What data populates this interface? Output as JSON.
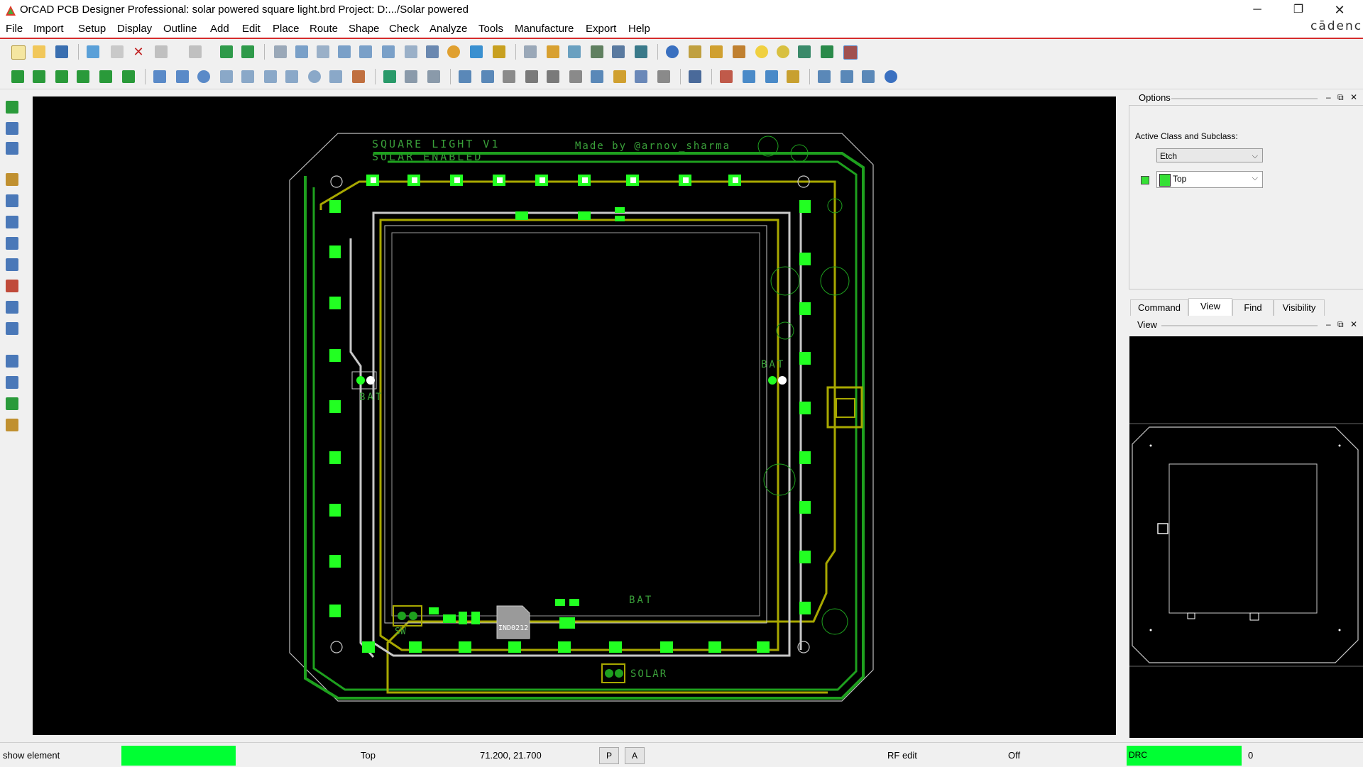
{
  "window": {
    "title": "OrCAD PCB Designer Professional: solar powered square light.brd  Project: D:.../Solar powered",
    "minimize_symbol": "─",
    "maximize_symbol": "❐",
    "close_symbol": "✕"
  },
  "brand": "cādence",
  "menu": [
    {
      "label": "File"
    },
    {
      "label": "Import"
    },
    {
      "label": "Setup"
    },
    {
      "label": "Display"
    },
    {
      "label": "Outline"
    },
    {
      "label": "Add"
    },
    {
      "label": "Edit"
    },
    {
      "label": "Place"
    },
    {
      "label": "Route"
    },
    {
      "label": "Shape"
    },
    {
      "label": "Check"
    },
    {
      "label": "Analyze"
    },
    {
      "label": "Tools"
    },
    {
      "label": "Manufacture"
    },
    {
      "label": "Export"
    },
    {
      "label": "Help"
    }
  ],
  "board": {
    "silkscreen_title_line1": "SQUARE LIGHT V1",
    "silkscreen_title_line2": "SOLAR ENABLED",
    "silkscreen_credit": "Made by @arnov_sharma",
    "label_bat_left": "BAT",
    "label_bat_right": "BAT",
    "label_bat_bottom": "BAT",
    "label_sw": "SW",
    "label_solar": "SOLAR",
    "label_ic": "IND0212"
  },
  "colors": {
    "etch_green": "#1ea01e",
    "bright_green": "#22ff22",
    "copper_yellow": "#a8a800",
    "trace_grey": "#c8c8c8",
    "silk_green": "#3aa03a",
    "status_green": "#00ff33"
  },
  "options_panel": {
    "title": "Options",
    "active_class_label": "Active Class and Subclass:",
    "class_value": "Etch",
    "subclass_value": "Top"
  },
  "tabs": [
    {
      "label": "Command"
    },
    {
      "label": "View"
    },
    {
      "label": "Find"
    },
    {
      "label": "Visibility"
    }
  ],
  "view_panel": {
    "title": "View"
  },
  "statusbar": {
    "message": "show element",
    "active_layer": "Top",
    "coordinates": "71.200, 21.700",
    "btn_p": "P",
    "btn_a": "A",
    "mode": "RF edit",
    "state": "Off",
    "drc_label": "DRC",
    "drc_count": "0"
  }
}
